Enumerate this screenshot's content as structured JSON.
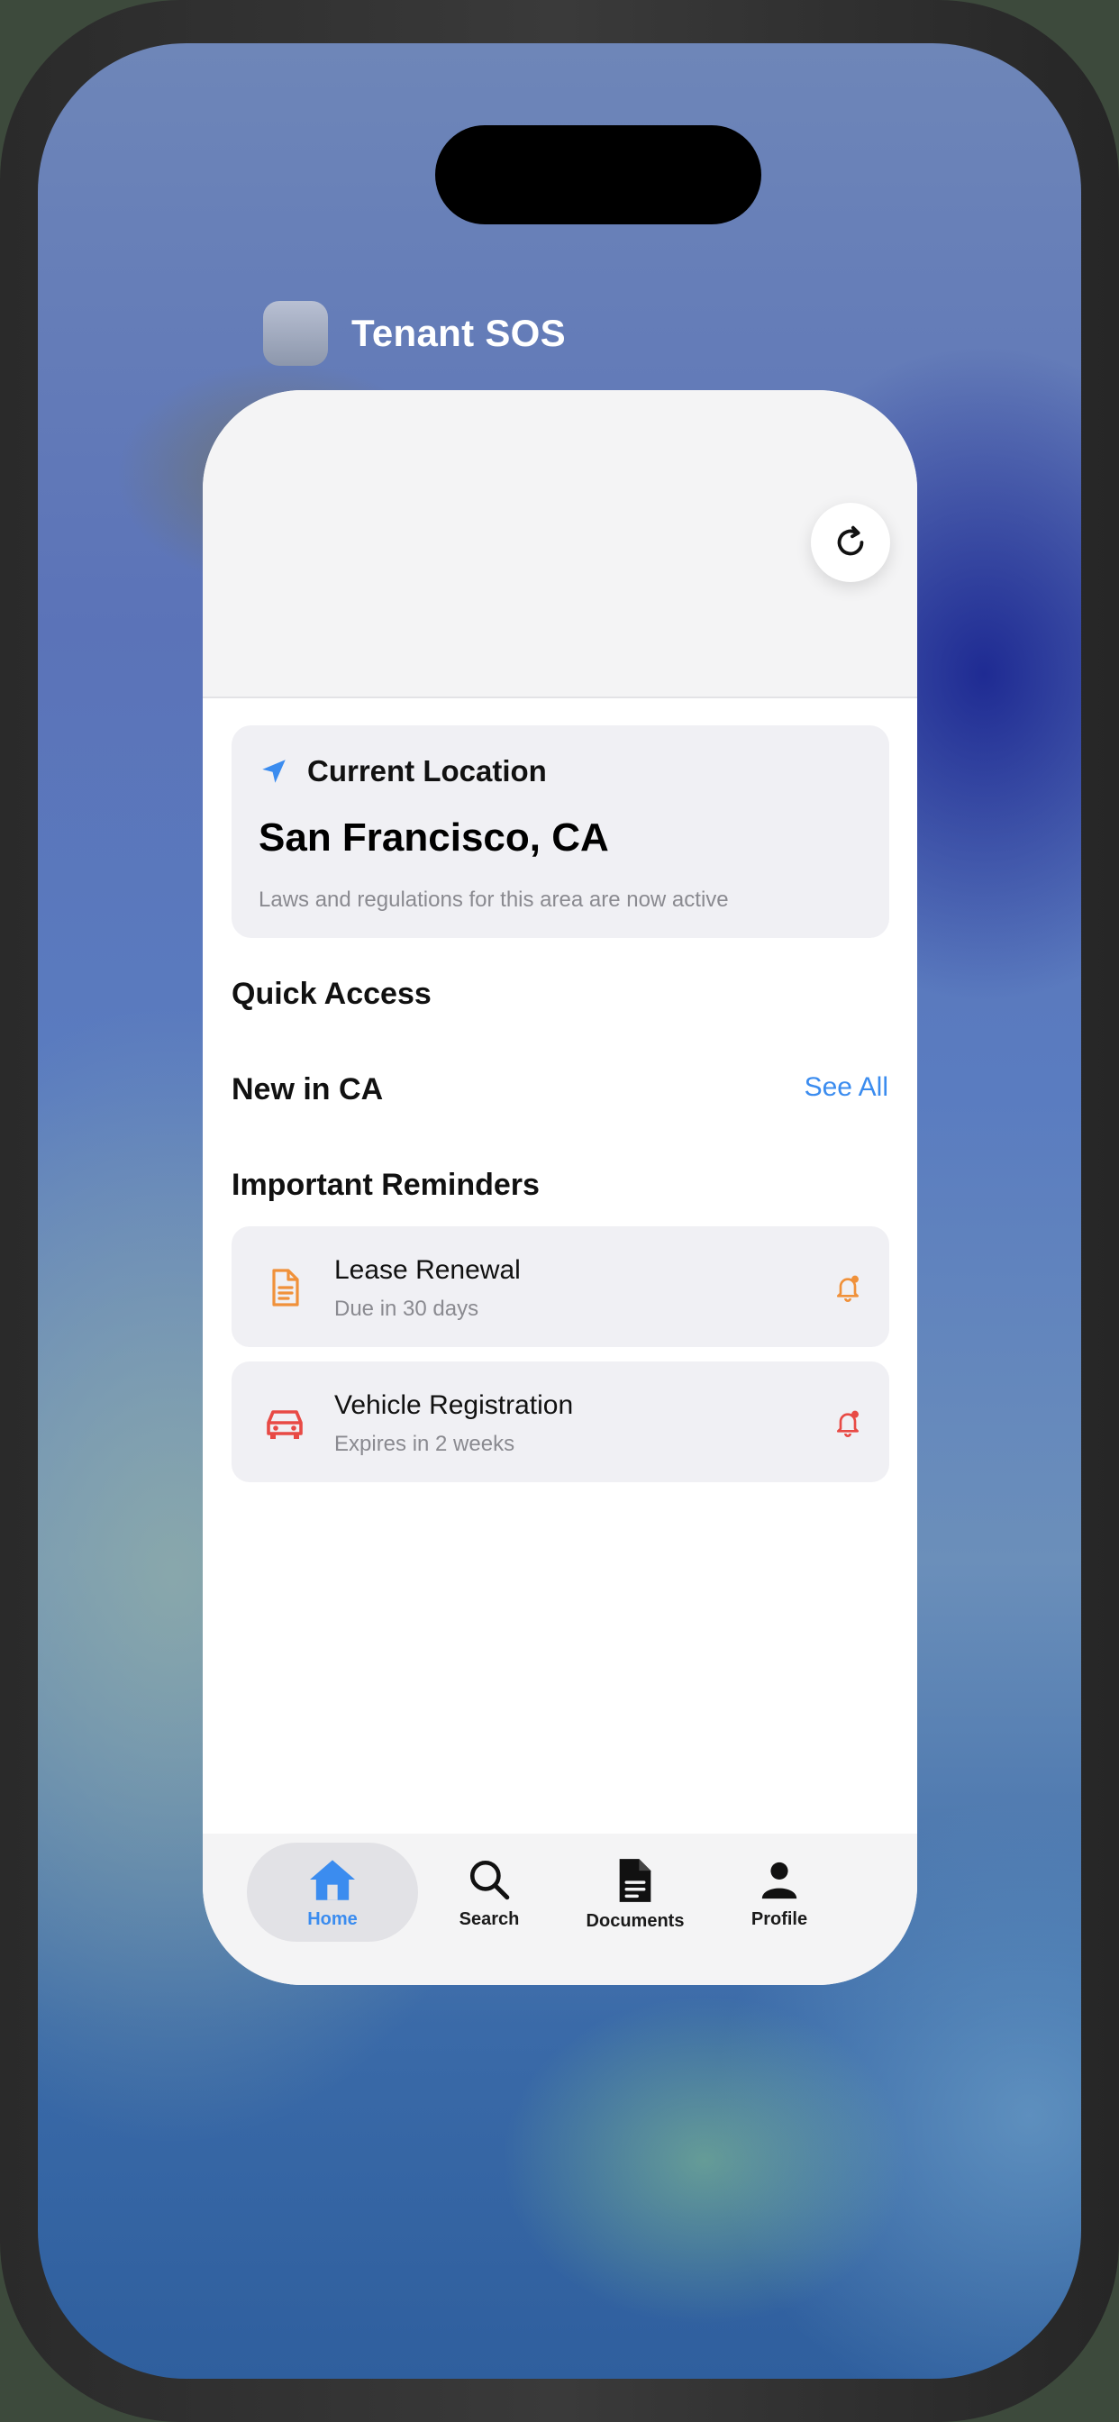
{
  "app_switcher": {
    "app_name": "Tenant SOS"
  },
  "location": {
    "heading": "Current Location",
    "city": "San Francisco, CA",
    "note": "Laws and regulations for this area are now active"
  },
  "sections": {
    "quick_access": "Quick Access",
    "new_in": "New in CA",
    "see_all": "See All",
    "reminders": "Important Reminders"
  },
  "reminders": [
    {
      "title": "Lease Renewal",
      "subtitle": "Due in 30 days",
      "icon": "document-icon",
      "color": "#f0913a"
    },
    {
      "title": "Vehicle Registration",
      "subtitle": "Expires in 2 weeks",
      "icon": "car-icon",
      "color": "#e84a45"
    }
  ],
  "tabs": [
    {
      "label": "Home",
      "icon": "house-icon",
      "active": true
    },
    {
      "label": "Search",
      "icon": "magnifier-icon",
      "active": false
    },
    {
      "label": "Documents",
      "icon": "document-icon",
      "active": false
    },
    {
      "label": "Profile",
      "icon": "person-icon",
      "active": false
    }
  ],
  "colors": {
    "accent": "#3b8cef",
    "orange": "#f0913a",
    "red": "#e84a45"
  }
}
